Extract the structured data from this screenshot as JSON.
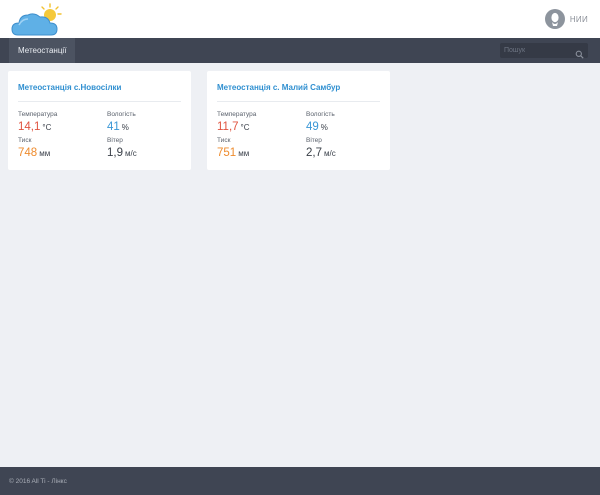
{
  "header": {
    "logo_icon": "cloud-sun-icon",
    "user_name": "НИИ",
    "user_icon": "user-avatar-icon"
  },
  "nav": {
    "tabs": [
      {
        "label": "Метеостанції",
        "active": true
      }
    ],
    "search_placeholder": "Пошук",
    "search_icon": "search-icon"
  },
  "stations": [
    {
      "title": "Метеостанція с.Новосілки",
      "temperature": {
        "label": "Температура",
        "value": "14,1",
        "unit": "°C"
      },
      "humidity": {
        "label": "Вологість",
        "value": "41",
        "unit": "%"
      },
      "pressure": {
        "label": "Тиск",
        "value": "748",
        "unit": "мм"
      },
      "wind": {
        "label": "Вітер",
        "value": "1,9",
        "unit": "м/с"
      }
    },
    {
      "title": "Метеостанція с. Малий Самбур",
      "temperature": {
        "label": "Температура",
        "value": "11,7",
        "unit": "°C"
      },
      "humidity": {
        "label": "Вологість",
        "value": "49",
        "unit": "%"
      },
      "pressure": {
        "label": "Тиск",
        "value": "751",
        "unit": "мм"
      },
      "wind": {
        "label": "Вітер",
        "value": "2,7",
        "unit": "м/с"
      }
    }
  ],
  "footer": {
    "text": "© 2016 All Ti - Лінкс"
  },
  "colors": {
    "accent": "#2f8fd0",
    "temperature": "#e0533f",
    "humidity": "#3a97d6",
    "pressure": "#ee8b2d",
    "navbar": "#3f4553",
    "background": "#eef0f4"
  }
}
